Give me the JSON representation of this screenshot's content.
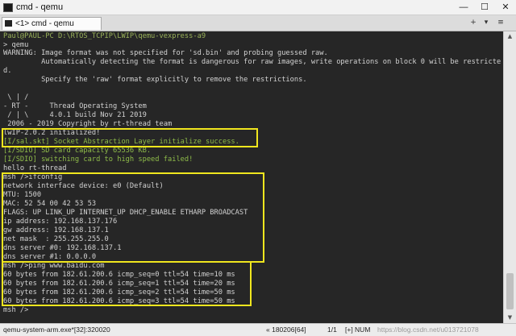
{
  "window": {
    "title": "cmd - qemu",
    "minimize_glyph": "—",
    "maximize_glyph": "☐",
    "close_glyph": "✕"
  },
  "tabbar": {
    "tab_label": "<1> cmd - qemu",
    "add_glyph": "+",
    "dropdown_glyph": "▾",
    "menu_glyph": "≡"
  },
  "terminal": {
    "path_prompt": "Paul@PAUL-PC D:\\RTOS_TCPIP\\LWIP\\qemu-vexpress-a9",
    "command": "> qemu",
    "lines": [
      "WARNING: Image format was not specified for 'sd.bin' and probing guessed raw.",
      "         Automatically detecting the format is dangerous for raw images, write operations on block 0 will be restricte",
      "d.",
      "         Specify the 'raw' format explicitly to remove the restrictions.",
      "",
      " \\ | /",
      "- RT -     Thread Operating System",
      " / | \\     4.0.1 build Nov 21 2019",
      " 2006 - 2019 Copyright by rt-thread team",
      "lwIP-2.0.2 initialized!",
      "[I/sal.skt] Socket Abstraction Layer initialize success.",
      "[I/SDIO] SD card capacity 65536 KB.",
      "[I/SDIO] switching card to high speed failed!",
      "hello rt-thread",
      "msh />ifconfig",
      "network interface device: e0 (Default)",
      "MTU: 1500",
      "MAC: 52 54 00 42 53 53",
      "FLAGS: UP LINK_UP INTERNET_UP DHCP_ENABLE ETHARP BROADCAST",
      "ip address: 192.168.137.176",
      "gw address: 192.168.137.1",
      "net mask  : 255.255.255.0",
      "dns server #0: 192.168.137.1",
      "dns server #1: 0.0.0.0",
      "msh />ping www.baidu.com",
      "60 bytes from 182.61.200.6 icmp_seq=0 ttl=54 time=10 ms",
      "60 bytes from 182.61.200.6 icmp_seq=1 ttl=54 time=20 ms",
      "60 bytes from 182.61.200.6 icmp_seq=2 ttl=54 time=50 ms",
      "60 bytes from 182.61.200.6 icmp_seq=3 ttl=54 time=50 ms",
      "msh />"
    ],
    "colors": {
      "background": "#262626",
      "text": "#d2d2d2",
      "prompt": "#d87aa0",
      "path": "#9ab25a",
      "log_green": "#8fbc4a",
      "highlight_box": "#f0e61e"
    }
  },
  "statusbar": {
    "process": "qemu-system-arm.exe*[32]:320020",
    "encoding": "« 180206[64]",
    "position": "1/1",
    "mode": "[+] NUM",
    "watermark": "https://blog.csdn.net/u013721078"
  }
}
